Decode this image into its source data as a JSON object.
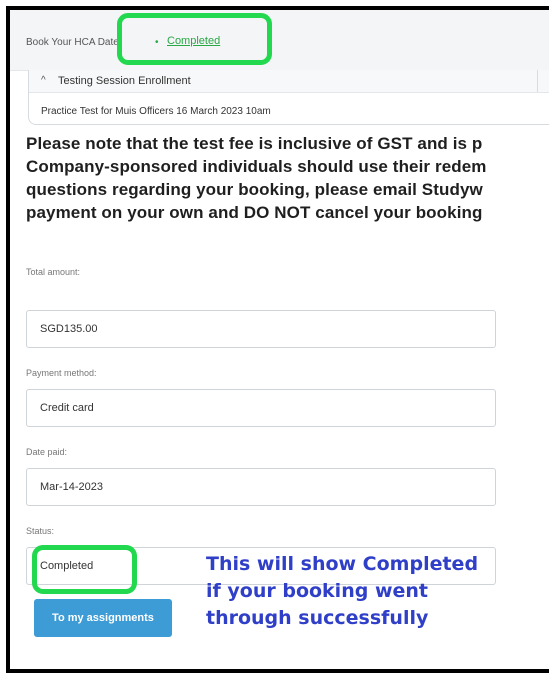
{
  "breadcrumb": {
    "first": "Book Your HCA Date",
    "bullet": "•",
    "active": "Completed"
  },
  "panel": {
    "chevron": "^",
    "title": "Testing Session Enrollment",
    "row": "Practice Test for Muis Officers 16 March 2023 10am"
  },
  "notice": {
    "lines": [
      "Please note that the test fee is inclusive of GST and is p",
      "Company-sponsored individuals should use their redem",
      "questions regarding your booking, please email Studyw",
      "payment on your own and DO NOT cancel your booking"
    ]
  },
  "form": {
    "total_amount": {
      "label": "Total amount:",
      "value": "SGD135.00"
    },
    "payment_method": {
      "label": "Payment method:",
      "value": "Credit card"
    },
    "date_paid": {
      "label": "Date paid:",
      "value": "Mar-14-2023"
    },
    "status": {
      "label": "Status:",
      "value": "Completed"
    }
  },
  "button": {
    "label": "To my assignments"
  },
  "annotation": {
    "lines": [
      "This will show Completed",
      "if your booking went",
      "through successfully"
    ]
  },
  "colors": {
    "highlight": "#22d84f",
    "link": "#28a745",
    "button": "#3d9bd5",
    "annotation": "#2f3fc8"
  },
  "icons": {
    "panel_toggle": "chevron-up-icon"
  }
}
